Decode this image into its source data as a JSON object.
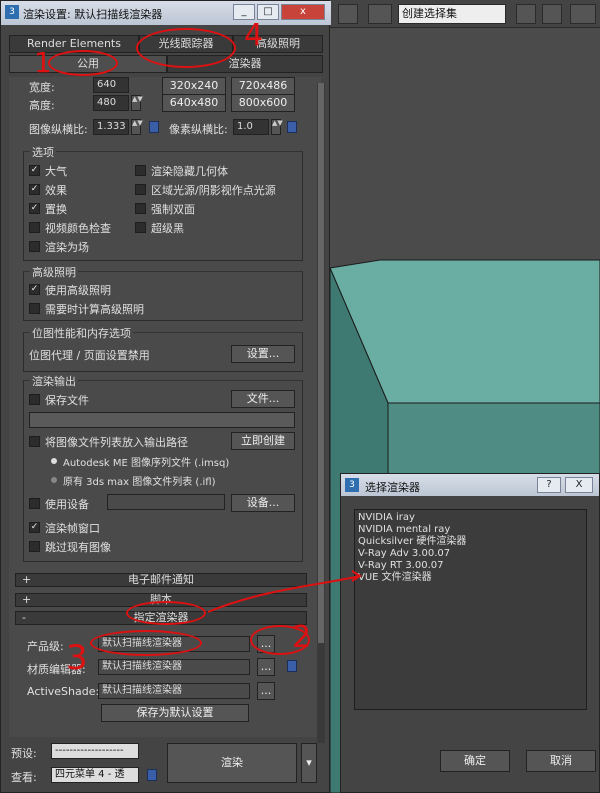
{
  "window": {
    "title": "渲染设置: 默认扫描线渲染器"
  },
  "tabs_row1": [
    {
      "label": "Render Elements"
    },
    {
      "label": "光线跟踪器"
    },
    {
      "label": "高级照明"
    }
  ],
  "tabs_row2": [
    {
      "label": "公用"
    },
    {
      "label": "渲染器"
    }
  ],
  "size": {
    "width_label": "宽度:",
    "width_value": "640",
    "height_label": "高度:",
    "height_value": "480",
    "presets": [
      "320x240",
      "720x486",
      "640x480",
      "800x600"
    ],
    "image_aspect_label": "图像纵横比:",
    "image_aspect_value": "1.333",
    "pixel_aspect_label": "像素纵横比:",
    "pixel_aspect_value": "1.0"
  },
  "options": {
    "title": "选项",
    "left": [
      {
        "label": "大气",
        "checked": true
      },
      {
        "label": "效果",
        "checked": true
      },
      {
        "label": "置换",
        "checked": true
      },
      {
        "label": "视频颜色检查",
        "checked": false
      },
      {
        "label": "渲染为场",
        "checked": false
      }
    ],
    "right": [
      {
        "label": "渲染隐藏几何体",
        "checked": false
      },
      {
        "label": "区域光源/阴影视作点光源",
        "checked": false
      },
      {
        "label": "强制双面",
        "checked": false
      },
      {
        "label": "超级黑",
        "checked": false
      }
    ]
  },
  "advanced_lighting": {
    "title": "高级照明",
    "items": [
      {
        "label": "使用高级照明",
        "checked": true
      },
      {
        "label": "需要时计算高级照明",
        "checked": false
      }
    ]
  },
  "bitmap": {
    "title": "位图性能和内存选项",
    "text": "位图代理 / 页面设置禁用",
    "button": "设置..."
  },
  "render_output": {
    "title": "渲染输出",
    "save_file": "保存文件",
    "files_button": "文件...",
    "put_list": "将图像文件列表放入输出路径",
    "create_now": "立即创建",
    "radio1": "Autodesk ME 图像序列文件 (.imsq)",
    "radio2": "原有 3ds max 图像文件列表 (.ifl)",
    "use_device": "使用设备",
    "devices_button": "设备...",
    "frame_window": "渲染帧窗口",
    "skip_existing": "跳过现有图像"
  },
  "rollouts": [
    {
      "sign": "+",
      "label": "电子邮件通知"
    },
    {
      "sign": "+",
      "label": "脚本"
    },
    {
      "sign": "-",
      "label": "指定渲染器"
    }
  ],
  "assign": {
    "production_label": "产品级:",
    "production_value": "默认扫描线渲染器",
    "material_label": "材质编辑器:",
    "material_value": "默认扫描线渲染器",
    "activeshade_label": "ActiveShade:",
    "activeshade_value": "默认扫描线渲染器",
    "ellipsis": "...",
    "save_default": "保存为默认设置"
  },
  "footer": {
    "preset_label": "预设:",
    "preset_value": "-------------------",
    "view_label": "查看:",
    "view_value": "四元菜单 4 - 透",
    "render_button": "渲染"
  },
  "toolbar": {
    "selection_set": "创建选择集"
  },
  "choose_renderer": {
    "title": "选择渲染器",
    "items": [
      "NVIDIA iray",
      "NVIDIA mental ray",
      "Quicksilver 硬件渲染器",
      "V-Ray Adv 3.00.07",
      "V-Ray RT 3.00.07",
      "VUE 文件渲染器"
    ],
    "ok": "确定",
    "cancel": "取消",
    "help": "?",
    "close": "X"
  },
  "annotation_numbers": [
    "1",
    "2",
    "3",
    "4"
  ],
  "colors": {
    "annotation": "#d11111",
    "cube": "#5a9a90",
    "accent": "#3a5fa8"
  }
}
